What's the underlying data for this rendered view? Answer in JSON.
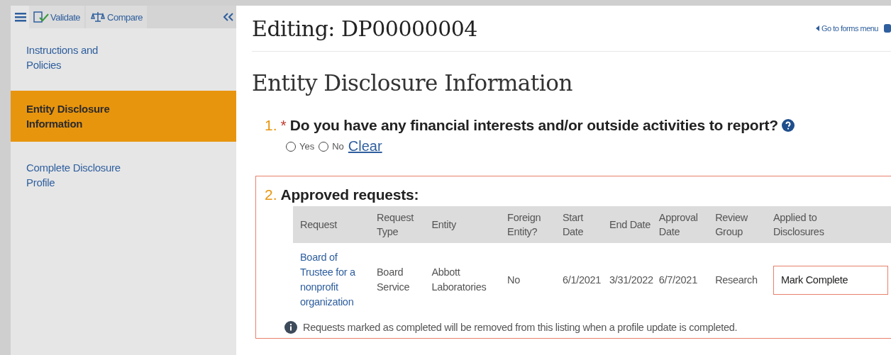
{
  "toolbar": {
    "validate": "Validate",
    "compare": "Compare"
  },
  "sidebar": {
    "items": [
      {
        "label": "Instructions and Policies",
        "selected": false
      },
      {
        "label": "Entity Disclosure Information",
        "selected": true
      },
      {
        "label": "Complete Disclosure Profile",
        "selected": false
      }
    ]
  },
  "header": {
    "title": "Editing: DP00000004",
    "back_link": "Go to forms menu"
  },
  "section_title": "Entity Disclosure Information",
  "question1": {
    "number": "1.",
    "required": true,
    "required_mark": "*",
    "text": "Do you have any financial interests and/or outside activities to report?",
    "options": [
      {
        "label": "Yes",
        "selected": false
      },
      {
        "label": "No",
        "selected": false
      }
    ],
    "clear": "Clear"
  },
  "question2": {
    "number": "2.",
    "text": "Approved requests:",
    "table": {
      "columns": [
        "Request",
        "Request Type",
        "Entity",
        "Foreign Entity?",
        "Start Date",
        "End Date",
        "Approval Date",
        "Review Group",
        "Applied to Disclosures"
      ],
      "rows": [
        {
          "cells": [
            "Board of Trustee for a nonprofit organization",
            "Board Service",
            "Abbott Laboratories",
            "No",
            "6/1/2021",
            "3/31/2022",
            "6/7/2021",
            "Research",
            "Mark Complete"
          ]
        }
      ]
    },
    "note": "Requests marked as completed will be removed from this listing when a profile update is completed."
  }
}
